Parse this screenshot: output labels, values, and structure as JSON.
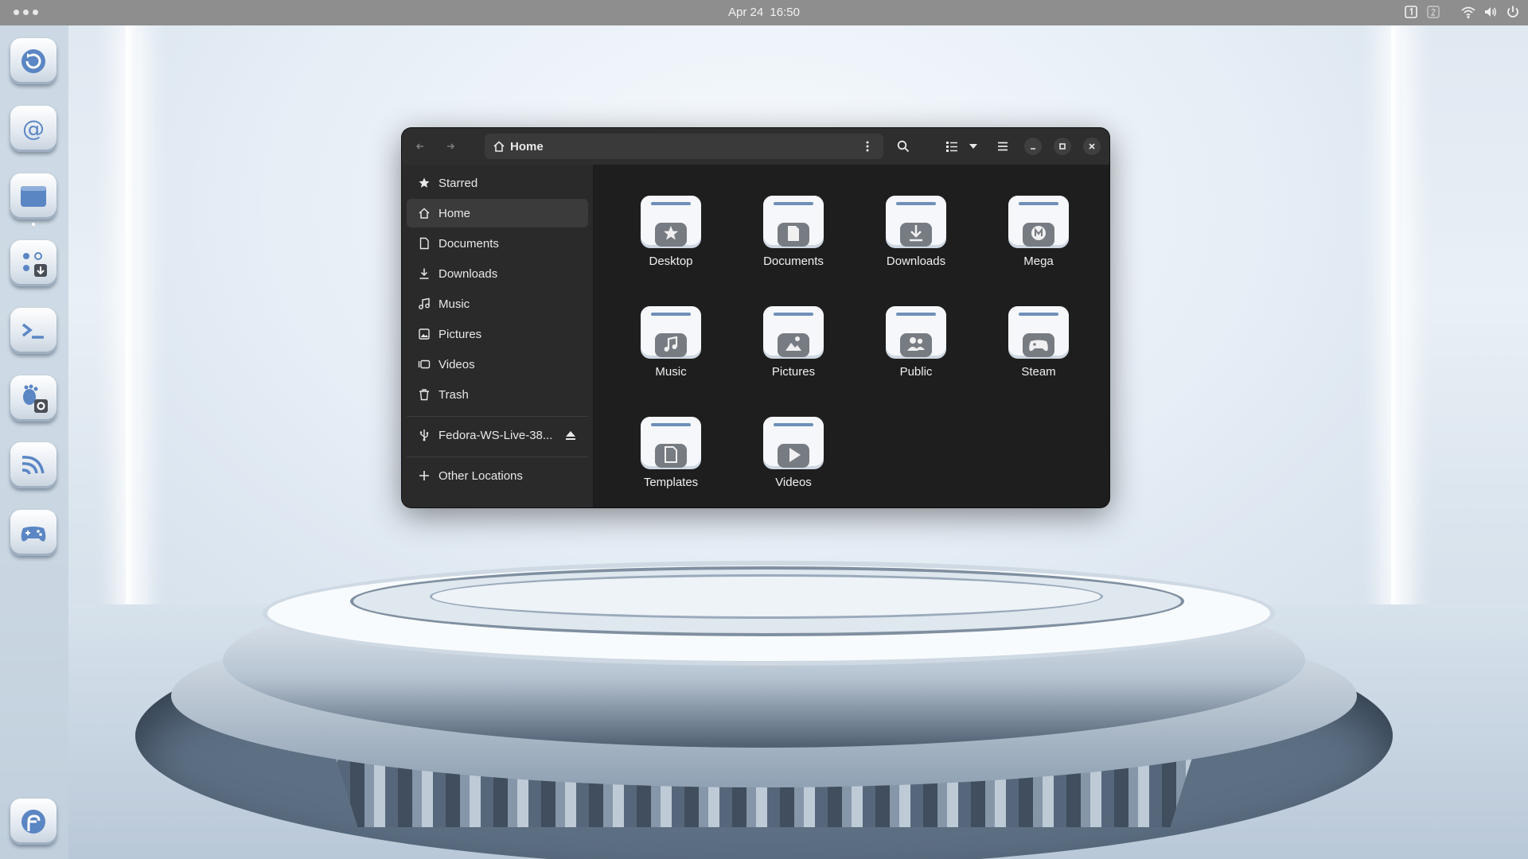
{
  "topbar": {
    "date": "Apr 24",
    "time": "16:50",
    "tray_icons": [
      "workspace-1-icon",
      "workspace-2-icon",
      "wifi-icon",
      "volume-icon",
      "power-icon"
    ]
  },
  "dock": {
    "apps": [
      "update-app-icon",
      "mail-app-icon",
      "files-app-icon",
      "software-app-icon",
      "terminal-app-icon",
      "settings-app-icon",
      "rss-app-icon",
      "games-app-icon",
      "fedora-app-icon"
    ]
  },
  "window": {
    "path": {
      "label": "Home"
    },
    "sidebar": {
      "items": [
        {
          "label": "Starred",
          "icon": "star-icon"
        },
        {
          "label": "Home",
          "icon": "home-icon",
          "selected": true
        },
        {
          "label": "Documents",
          "icon": "document-icon"
        },
        {
          "label": "Downloads",
          "icon": "download-icon"
        },
        {
          "label": "Music",
          "icon": "music-icon"
        },
        {
          "label": "Pictures",
          "icon": "picture-icon"
        },
        {
          "label": "Videos",
          "icon": "video-icon"
        },
        {
          "label": "Trash",
          "icon": "trash-icon"
        }
      ],
      "devices": [
        {
          "label": "Fedora-WS-Live-38...",
          "icon": "usb-icon"
        }
      ],
      "other": {
        "label": "Other Locations",
        "icon": "plus-icon"
      }
    },
    "folders": [
      {
        "name": "Desktop",
        "icon": "star-icon"
      },
      {
        "name": "Documents",
        "icon": "document-icon"
      },
      {
        "name": "Downloads",
        "icon": "download-icon"
      },
      {
        "name": "Mega",
        "icon": "mega-icon"
      },
      {
        "name": "Music",
        "icon": "music-icon"
      },
      {
        "name": "Pictures",
        "icon": "picture-icon"
      },
      {
        "name": "Public",
        "icon": "users-icon"
      },
      {
        "name": "Steam",
        "icon": "gamepad-icon"
      },
      {
        "name": "Templates",
        "icon": "template-icon"
      },
      {
        "name": "Videos",
        "icon": "play-icon"
      }
    ]
  },
  "colors": {
    "window_bg": "#242424",
    "header_bg": "#2e2e2e",
    "sidebar_bg": "#2a2a2a",
    "content_bg": "#1e1e1e",
    "folder_accent": "#6f8fb8",
    "topbar_bg": "#8e8e8e"
  }
}
